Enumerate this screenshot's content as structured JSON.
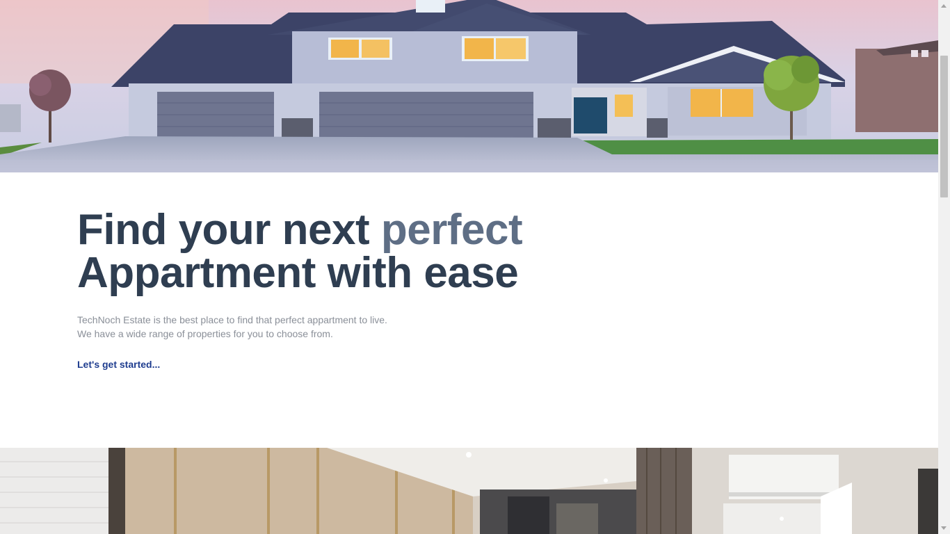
{
  "hero": {
    "image_icon": "house-exterior-photo",
    "headline_part1": "Find your next ",
    "headline_accent": "perfect",
    "headline_line2": "Appartment with ease",
    "description_line1": "TechNoch Estate is the best place to find that perfect appartment to live.",
    "description_line2": "We have a wide range of properties for you to choose from.",
    "cta_label": "Let's get started..."
  },
  "interior": {
    "image_icon": "interior-room-photo"
  },
  "colors": {
    "headline": "#2f3e51",
    "headline_accent": "#5e6e85",
    "body_text": "#8a8f98",
    "link": "#1f3d8f"
  },
  "scrollbar": {
    "position_fraction": 0.09
  }
}
